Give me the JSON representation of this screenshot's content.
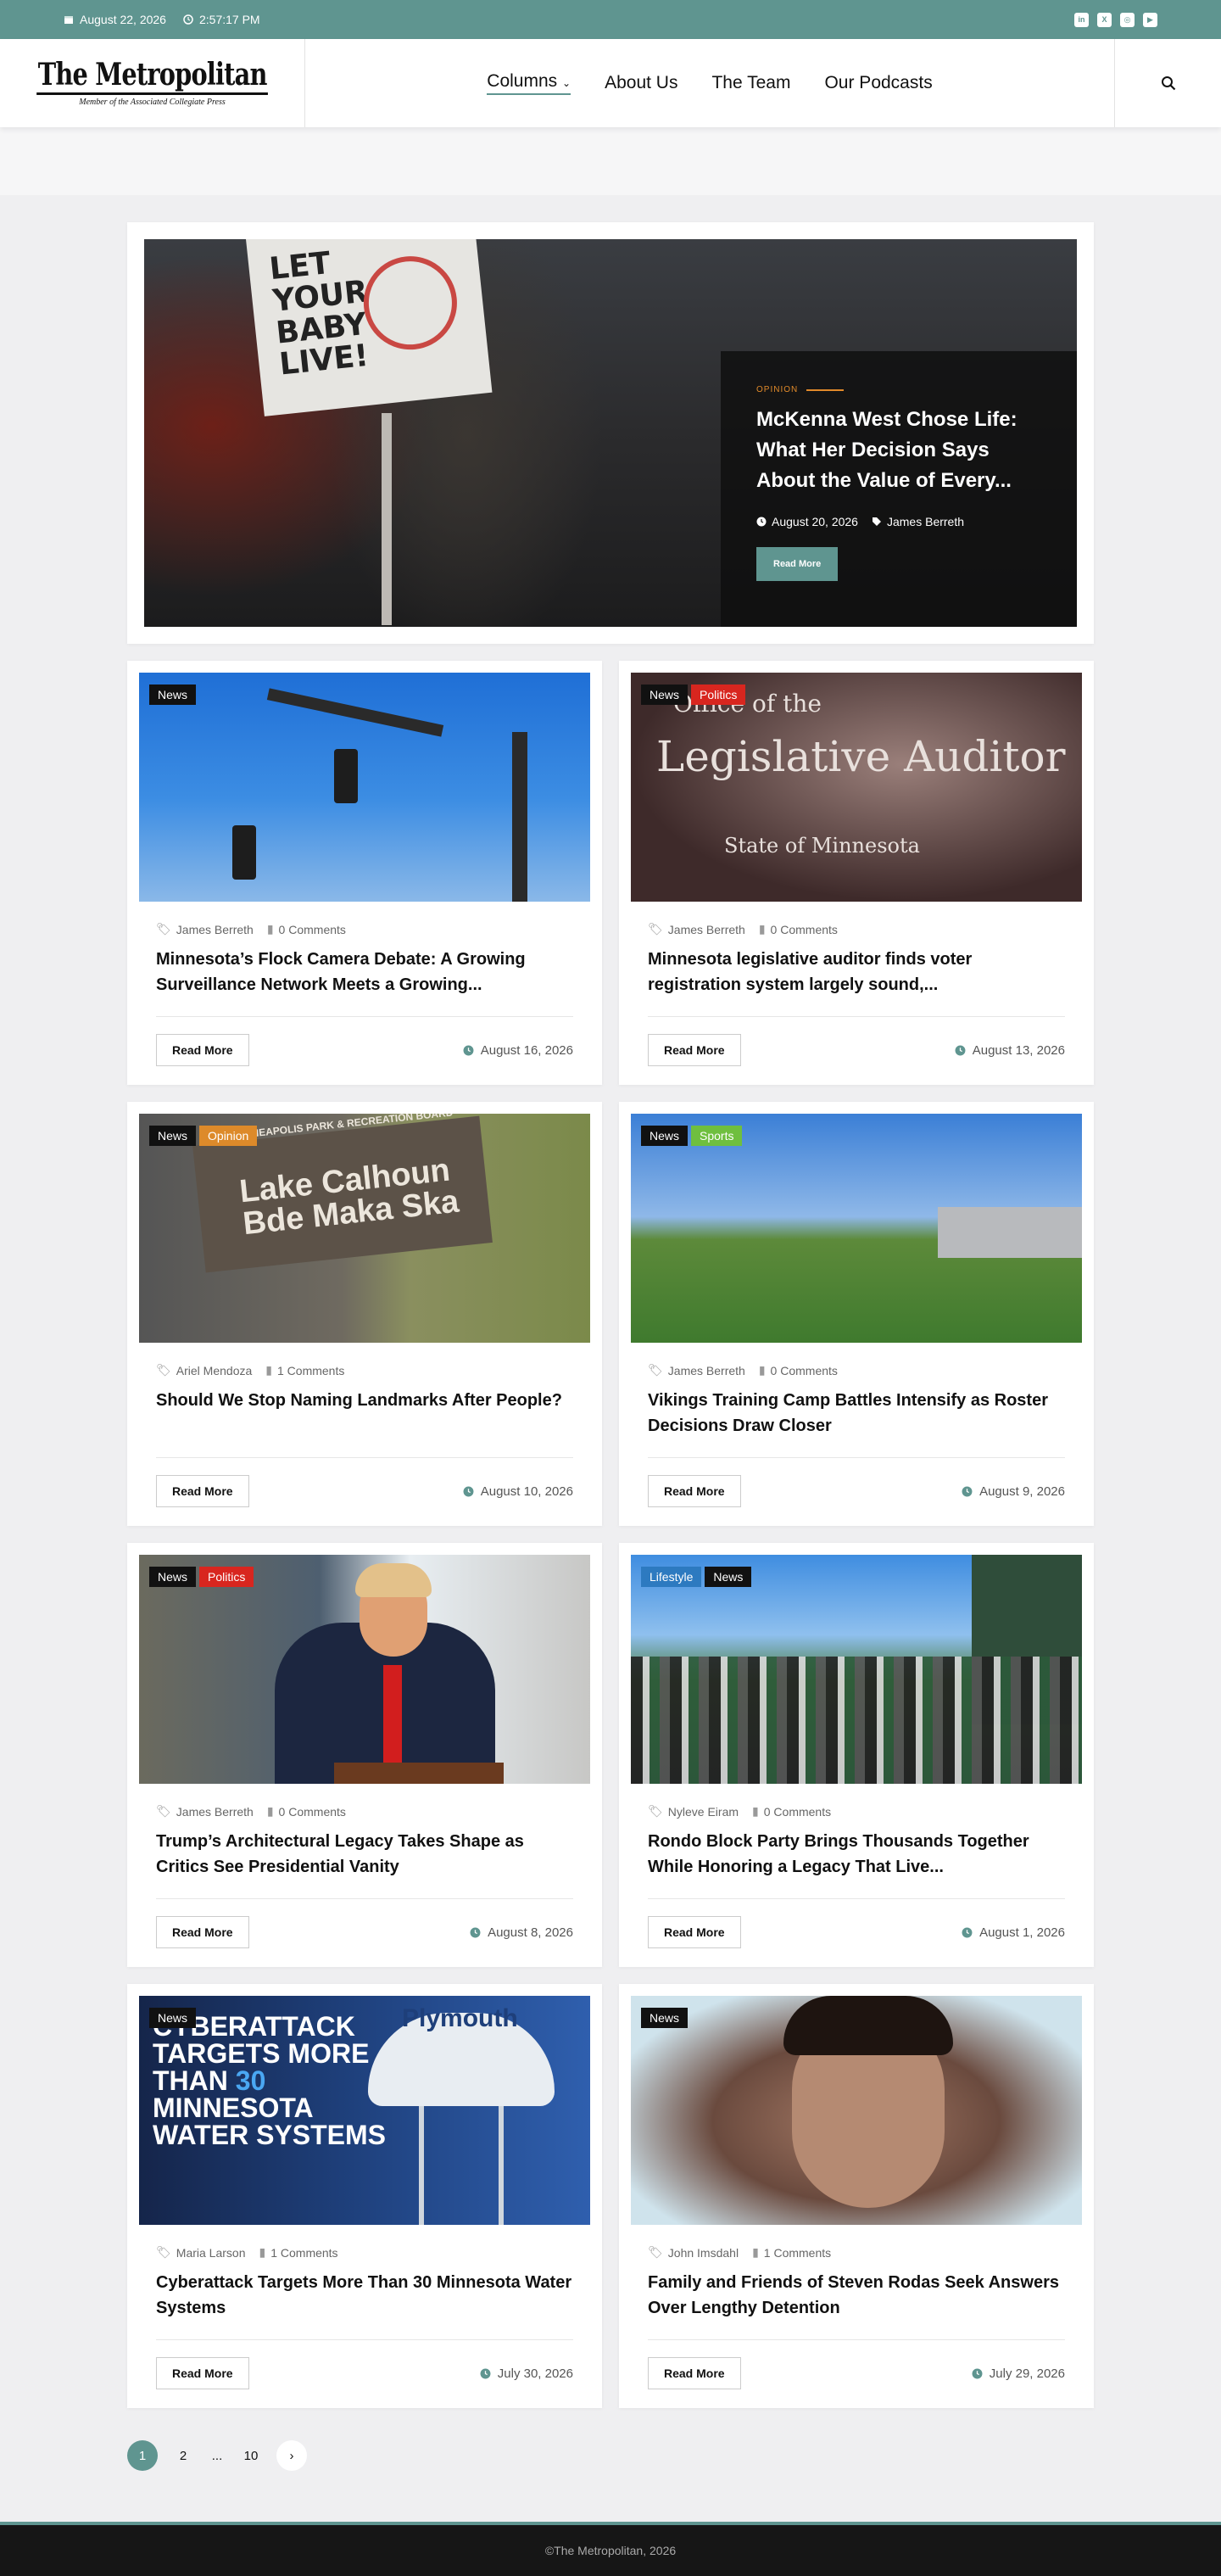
{
  "topbar": {
    "date": "August 22, 2026",
    "time": "2:57:17 PM",
    "social": [
      "linkedin-icon",
      "x-icon",
      "instagram-icon",
      "youtube-icon"
    ]
  },
  "header": {
    "logo_title": "The Metropolitan",
    "logo_subtitle": "Member of the Associated Collegiate Press",
    "nav": [
      {
        "label": "Columns"
      },
      {
        "label": "About Us"
      },
      {
        "label": "The Team"
      },
      {
        "label": "Our Podcasts"
      }
    ]
  },
  "hero": {
    "sign_text": "LET YOUR BABY LIVE!",
    "category": "OPINION",
    "title": "McKenna West Chose Life: What Her Decision Says About the Value of Every...",
    "date": "August 20, 2026",
    "author": "James Berreth",
    "button": "Read More"
  },
  "thumb_text": {
    "auditor_top": "Office of the",
    "auditor_main": "Legislative Auditor",
    "auditor_state": "State of Minnesota",
    "landmark_top": "MINNEAPOLIS PARK & RECREATION BOARD",
    "landmark_main": "Lake Calhoun",
    "landmark_sub": "Bde Maka Ska",
    "cyber_lines": [
      "CYBERATTACK",
      "TARGETS MORE",
      "THAN",
      "30",
      "MINNESOTA",
      "WATER SYSTEMS"
    ],
    "tower": "Plymouth"
  },
  "posts": [
    {
      "tags": [
        "News"
      ],
      "author": "James Berreth",
      "comments": "0 Comments",
      "title": "Minnesota’s Flock Camera Debate: A Growing Surveillance Network Meets a Growing...",
      "date": "August 16, 2026",
      "button": "Read More"
    },
    {
      "tags": [
        "News",
        "Politics"
      ],
      "author": "James Berreth",
      "comments": "0 Comments",
      "title": "Minnesota legislative auditor finds voter registration system largely sound,...",
      "date": "August 13, 2026",
      "button": "Read More"
    },
    {
      "tags": [
        "News",
        "Opinion"
      ],
      "author": "Ariel Mendoza",
      "comments": "1 Comments",
      "title": "Should We Stop Naming Landmarks After People?",
      "date": "August 10, 2026",
      "button": "Read More"
    },
    {
      "tags": [
        "News",
        "Sports"
      ],
      "author": "James Berreth",
      "comments": "0 Comments",
      "title": "Vikings Training Camp Battles Intensify as Roster Decisions Draw Closer",
      "date": "August 9, 2026",
      "button": "Read More"
    },
    {
      "tags": [
        "News",
        "Politics"
      ],
      "author": "James Berreth",
      "comments": "0 Comments",
      "title": "Trump’s Architectural Legacy Takes Shape as Critics See Presidential Vanity",
      "date": "August 8, 2026",
      "button": "Read More"
    },
    {
      "tags": [
        "Lifestyle",
        "News"
      ],
      "author": "Nyleve Eiram",
      "comments": "0 Comments",
      "title": "Rondo Block Party Brings Thousands Together While Honoring a Legacy That Live...",
      "date": "August 1, 2026",
      "button": "Read More"
    },
    {
      "tags": [
        "News"
      ],
      "author": "Maria Larson",
      "comments": "1 Comments",
      "title": "Cyberattack Targets More Than 30 Minnesota Water Systems",
      "date": "July 30, 2026",
      "button": "Read More"
    },
    {
      "tags": [
        "News"
      ],
      "author": "John Imsdahl",
      "comments": "1 Comments",
      "title": "Family and Friends of Steven Rodas Seek Answers Over Lengthy Detention",
      "date": "July 29, 2026",
      "button": "Read More"
    }
  ],
  "pagination": {
    "pages": [
      "1",
      "2",
      "...",
      "10"
    ],
    "current": "1"
  },
  "footer": {
    "text": "©The Metropolitan, 2026"
  },
  "colors": {
    "accent": "#5f9590",
    "politics": "#d8261f",
    "opinion": "#dd8a2a",
    "sports": "#6fbf3f",
    "lifestyle": "#2d7ac0"
  }
}
